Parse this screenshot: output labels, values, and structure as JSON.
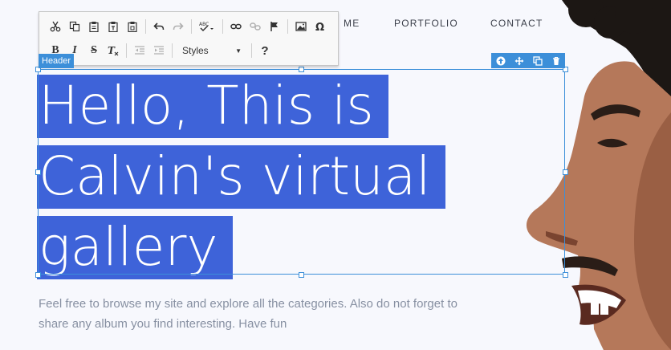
{
  "nav": {
    "home": "ME",
    "portfolio": "PORTFOLIO",
    "contact": "CONTACT"
  },
  "editor": {
    "element_label": "Header",
    "styles_label": "Styles",
    "help_label": "?"
  },
  "headline": {
    "line1": "Hello, This is",
    "line2": "Calvin's virtual",
    "line3": "gallery"
  },
  "lead": "Feel free to browse my site and explore all the categories. Also do not forget to share any album you find interesting. Have fun",
  "colors": {
    "selection": "#3e63d9",
    "frame": "#3c8fd9",
    "background": "#f7f8fd",
    "text_muted": "#8790a2"
  }
}
